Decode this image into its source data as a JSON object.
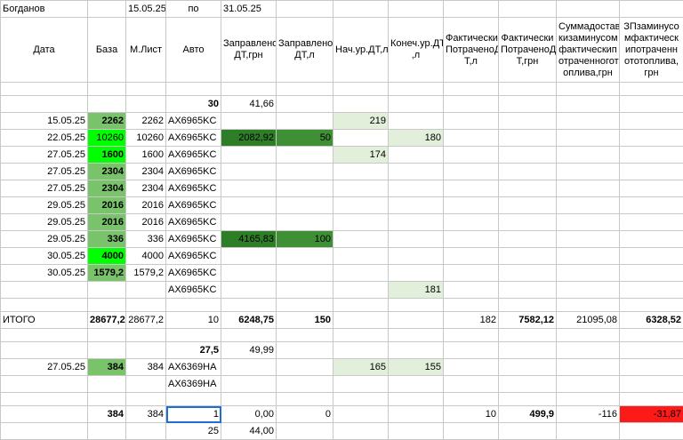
{
  "sheet": {
    "top": {
      "name": "Богданов",
      "date_from": "15.05.25",
      "po": "по",
      "date_to": "31.05.25"
    },
    "headers": [
      "Дата",
      "База",
      "М.Лист",
      "Авто",
      "Заправлено ДТ,грн",
      "Заправлено ДТ,л",
      "Нач.ур.ДТ,л",
      "Конеч.ур.ДТ ,л",
      "Фактически ПотраченоД Т,л",
      "Фактически ПотраченоД Т,грн",
      "Суммадостав кизаминусом фактическип отраченногот оплива,грн",
      "ЗПзаминусо мфактическ ипотраченн ототоплива, грн"
    ],
    "sum1": {
      "auto": "30",
      "zapr_grn": "41,66"
    },
    "rows": [
      {
        "date": "15.05.25",
        "baza": "2262",
        "ml": "2262",
        "auto": "AX6965KC",
        "zgrn": "",
        "zl": "",
        "nach": "219",
        "kon": ""
      },
      {
        "date": "22.05.25",
        "baza": "10260",
        "ml": "10260",
        "auto": "AX6965KC",
        "zgrn": "2082,92",
        "zl": "50",
        "nach": "",
        "kon": "180"
      },
      {
        "date": "27.05.25",
        "baza": "1600",
        "ml": "1600",
        "auto": "AX6965KC",
        "zgrn": "",
        "zl": "",
        "nach": "174",
        "kon": ""
      },
      {
        "date": "27.05.25",
        "baza": "2304",
        "ml": "2304",
        "auto": "AX6965KC",
        "zgrn": "",
        "zl": "",
        "nach": "",
        "kon": ""
      },
      {
        "date": "27.05.25",
        "baza": "2304",
        "ml": "2304",
        "auto": "AX6965KC",
        "zgrn": "",
        "zl": "",
        "nach": "",
        "kon": ""
      },
      {
        "date": "29.05.25",
        "baza": "2016",
        "ml": "2016",
        "auto": "AX6965KC",
        "zgrn": "",
        "zl": "",
        "nach": "",
        "kon": ""
      },
      {
        "date": "29.05.25",
        "baza": "2016",
        "ml": "2016",
        "auto": "AX6965KC",
        "zgrn": "",
        "zl": "",
        "nach": "",
        "kon": ""
      },
      {
        "date": "29.05.25",
        "baza": "336",
        "ml": "336",
        "auto": "AX6965KC",
        "zgrn": "4165,83",
        "zl": "100",
        "nach": "",
        "kon": ""
      },
      {
        "date": "30.05.25",
        "baza": "4000",
        "ml": "4000",
        "auto": "AX6965KC",
        "zgrn": "",
        "zl": "",
        "nach": "",
        "kon": ""
      },
      {
        "date": "30.05.25",
        "baza": "1579,2",
        "ml": "1579,2",
        "auto": "AX6965KC",
        "zgrn": "",
        "zl": "",
        "nach": "",
        "kon": ""
      },
      {
        "date": "",
        "baza": "",
        "ml": "",
        "auto": "AX6965KC",
        "zgrn": "",
        "zl": "",
        "nach": "",
        "kon": "181"
      }
    ],
    "itogo": {
      "label": "ИТОГО",
      "baza": "28677,2",
      "ml": "28677,2",
      "auto": "10",
      "zgrn": "6248,75",
      "zl": "150",
      "fl": "182",
      "fgrn": "7582,12",
      "sum": "21095,08",
      "zp": "6328,52"
    },
    "sum2": {
      "auto": "27,5",
      "zapr_grn": "49,99"
    },
    "rows2": [
      {
        "date": "27.05.25",
        "baza": "384",
        "ml": "384",
        "auto": "AX6369HA",
        "nach": "165",
        "kon": "155"
      },
      {
        "date": "",
        "baza": "",
        "ml": "",
        "auto": "AX6369HA",
        "nach": "",
        "kon": ""
      }
    ],
    "total2": {
      "baza": "384",
      "ml": "384",
      "auto": "1",
      "zgrn": "0,00",
      "zl": "0",
      "fl": "10",
      "fgrn": "499,9",
      "sum": "-116",
      "zp": "-31,87"
    },
    "partial": {
      "auto": "25",
      "zapr_grn": "44,00"
    }
  }
}
